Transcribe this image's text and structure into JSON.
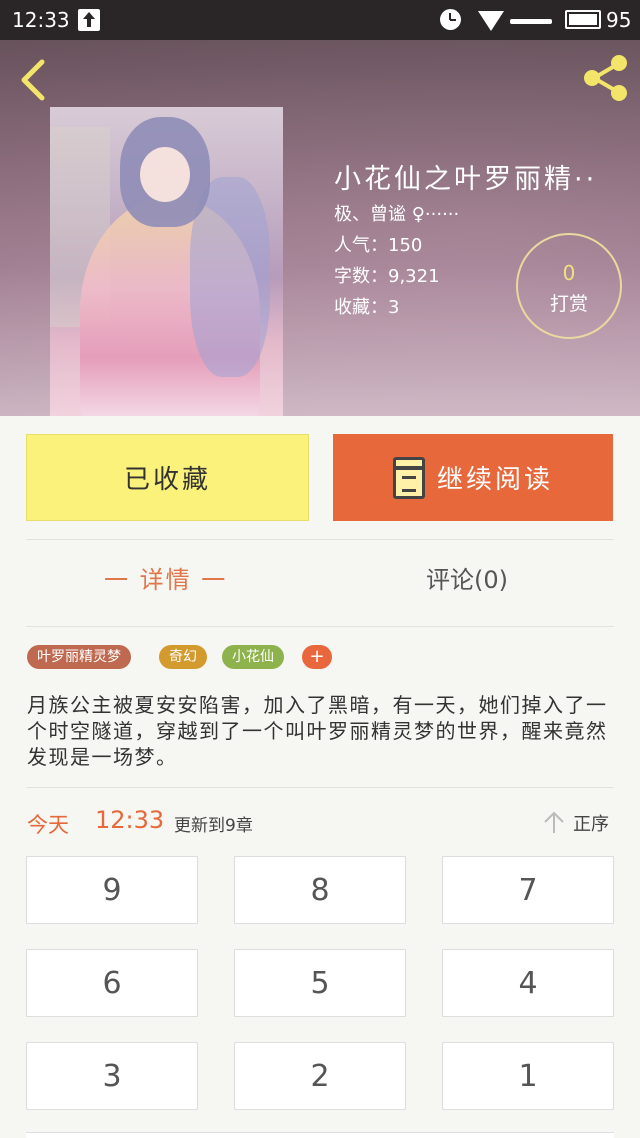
{
  "status_bar": {
    "time": "12:33",
    "battery": "95"
  },
  "book": {
    "title": "小花仙之叶罗丽精··",
    "author": "极、曾谧 ♀······",
    "popularity": "人气：150",
    "word_count": "字数：9,321",
    "favorites": "收藏：3",
    "reward_count": "0",
    "reward_label": "打赏"
  },
  "actions": {
    "favorite_label": "已收藏",
    "continue_label": "继续阅读"
  },
  "tabs": [
    {
      "label": "一  详情  一"
    },
    {
      "label": "评论(0)"
    }
  ],
  "tags": [
    "叶罗丽精灵梦",
    "奇幻",
    "小花仙",
    "+"
  ],
  "description": "月族公主被夏安安陷害，加入了黑暗，有一天，她们掉入了一个时空隧道，穿越到了一个叫叶罗丽精灵梦的世界，醒来竟然发现是一场梦。",
  "update": {
    "day": "今天",
    "time": "12:33",
    "text": "更新到9章",
    "sort_label": "正序"
  },
  "chapters": [
    "9",
    "8",
    "7",
    "6",
    "5",
    "4",
    "3",
    "2",
    "1"
  ],
  "colors": {
    "accent": "#e7683b",
    "favorite": "#fbf27b"
  },
  "icons": [
    "back-icon",
    "share-icon",
    "book-icon",
    "sort-arrow-icon"
  ]
}
